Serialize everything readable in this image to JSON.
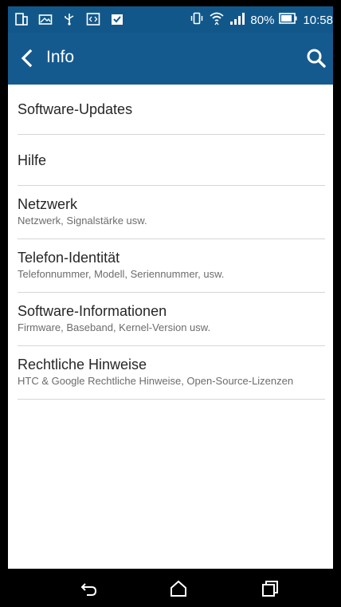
{
  "status_bar": {
    "left_icons": [
      "device-icon",
      "image-icon",
      "usb-icon",
      "code-icon",
      "clipboard-check-icon"
    ],
    "vibrate_icon": "vibrate-icon",
    "wifi_icon": "wifi-icon",
    "signal_icon": "signal-icon",
    "battery_percent": "80%",
    "battery_icon": "battery-icon",
    "time": "10:58"
  },
  "app_bar": {
    "title": "Info",
    "back_icon": "chevron-left-icon",
    "search_icon": "search-icon",
    "color": "#155a8f"
  },
  "list": {
    "items": [
      {
        "title": "Software-Updates",
        "subtitle": ""
      },
      {
        "title": "Hilfe",
        "subtitle": ""
      },
      {
        "title": "Netzwerk",
        "subtitle": "Netzwerk, Signalstärke usw."
      },
      {
        "title": "Telefon-Identität",
        "subtitle": "Telefonnummer, Modell, Seriennummer, usw."
      },
      {
        "title": "Software-Informationen",
        "subtitle": "Firmware, Baseband, Kernel-Version usw."
      },
      {
        "title": "Rechtliche Hinweise",
        "subtitle": "HTC & Google Rechtliche Hinweise, Open-Source-Lizenzen"
      }
    ]
  },
  "nav_bar": {
    "back_icon": "back-arrow-icon",
    "home_icon": "home-icon",
    "recents_icon": "recents-icon"
  }
}
